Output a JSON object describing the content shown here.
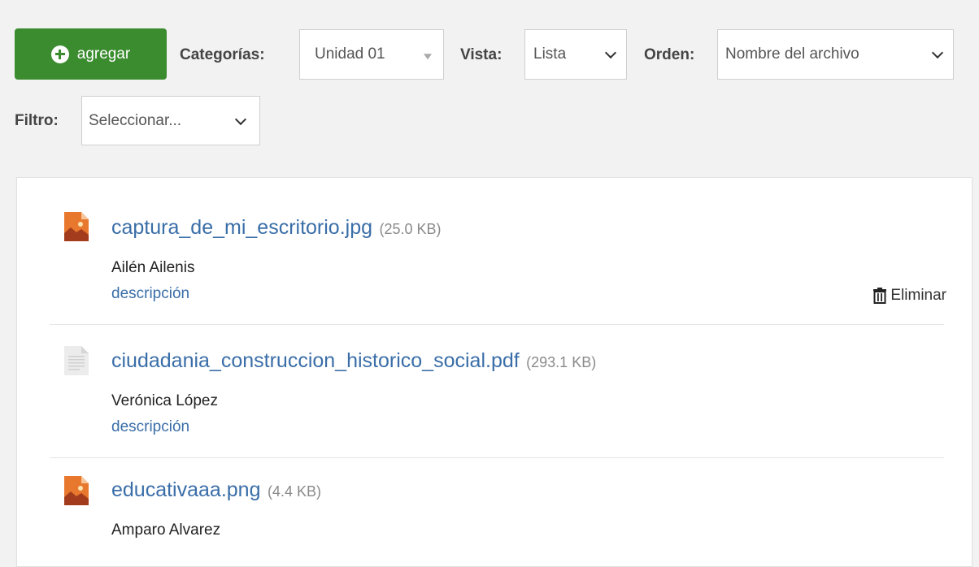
{
  "toolbar": {
    "add_label": "agregar",
    "categories_label": "Categorías:",
    "categories_value": "Unidad 01",
    "view_label": "Vista:",
    "view_value": "Lista",
    "order_label": "Orden:",
    "order_value": "Nombre del archivo",
    "filter_label": "Filtro:",
    "filter_value": "Seleccionar..."
  },
  "files": [
    {
      "name": "captura_de_mi_escritorio.jpg",
      "size": "(25.0 KB)",
      "author": "Ailén Ailenis",
      "description": "descripción",
      "delete_label": "Eliminar",
      "icon": "image-file-icon"
    },
    {
      "name": "ciudadania_construccion_historico_social.pdf",
      "size": "(293.1 KB)",
      "author": "Verónica López",
      "description": "descripción",
      "icon": "document-file-icon"
    },
    {
      "name": "educativaaa.png",
      "size": "(4.4 KB)",
      "author": "Amparo Alvarez",
      "icon": "image-file-icon"
    }
  ],
  "colors": {
    "accent_green": "#3a8c2f",
    "link_blue": "#3a6ea8"
  }
}
